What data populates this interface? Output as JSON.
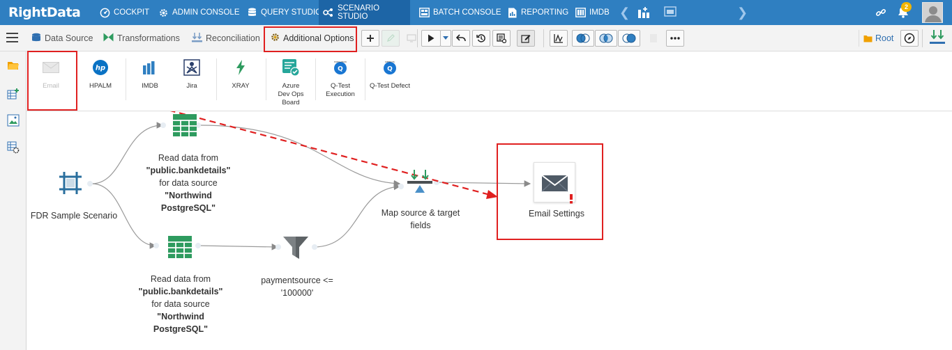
{
  "app": {
    "logo": "RightData"
  },
  "nav": {
    "items": [
      {
        "label": "COCKPIT"
      },
      {
        "label": "ADMIN CONSOLE"
      },
      {
        "label": "QUERY STUDIO"
      },
      {
        "label": "SCENARIO STUDIO"
      },
      {
        "label": "BATCH CONSOLE"
      },
      {
        "label": "REPORTING"
      },
      {
        "label": "IMDB"
      }
    ],
    "notifications_count": "2"
  },
  "toolbar": {
    "tabs": [
      {
        "label": "Data Source"
      },
      {
        "label": "Transformations"
      },
      {
        "label": "Reconciliation"
      },
      {
        "label": "Additional Options"
      }
    ],
    "root_label": "Root"
  },
  "options": [
    {
      "label": "Email"
    },
    {
      "label": "HPALM"
    },
    {
      "label": "IMDB"
    },
    {
      "label": "Jira"
    },
    {
      "label": "XRAY"
    },
    {
      "label": "Azure Dev Ops Board",
      "lines": [
        "Azure",
        "Dev Ops",
        "Board"
      ]
    },
    {
      "label": "Q-Test Execution",
      "lines": [
        "Q-Test",
        "Execution"
      ]
    },
    {
      "label": "Q-Test Defect"
    }
  ],
  "canvas": {
    "scenario": {
      "label": "FDR Sample Scenario"
    },
    "source_top": {
      "line1": "Read data from",
      "line2": "\"public.bankdetails\"",
      "line3": "for data source",
      "line4": "\"Northwind",
      "line5": "PostgreSQL\""
    },
    "source_bottom": {
      "line1": "Read data from",
      "line2": "\"public.bankdetails\"",
      "line3": "for data source",
      "line4": "\"Northwind",
      "line5": "PostgreSQL\""
    },
    "filter": {
      "line1": "paymentsource <=",
      "line2": "'100000'"
    },
    "map": {
      "line1": "Map source & target",
      "line2": "fields"
    },
    "email": {
      "label": "Email Settings"
    }
  },
  "colors": {
    "nav_bg": "#2f7fc1",
    "nav_active": "#1d65a6",
    "highlight": "#e02020",
    "table_icon": "#2e9b5f",
    "scenario_icon": "#2a6f9e"
  }
}
